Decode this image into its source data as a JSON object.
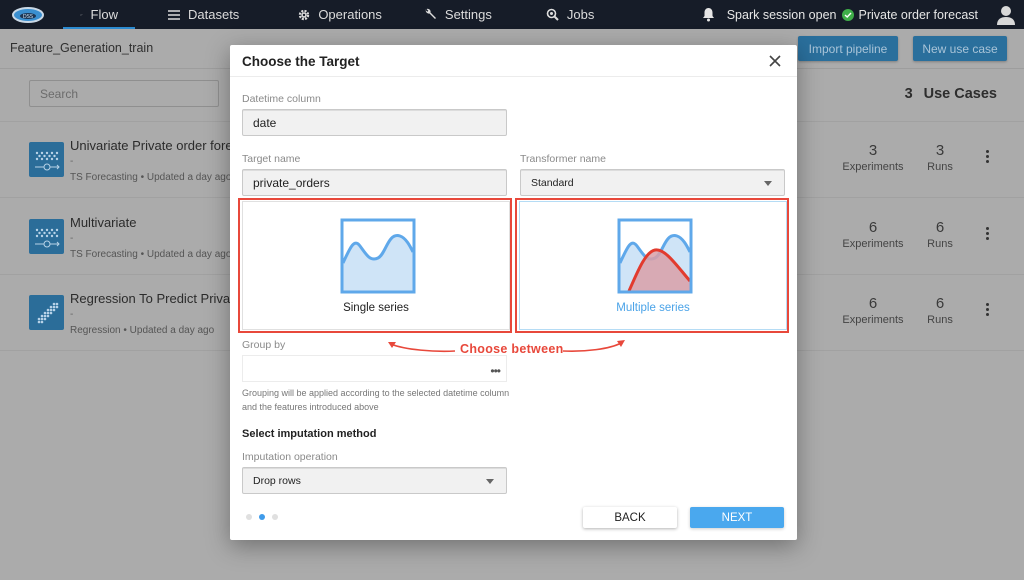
{
  "nav": {
    "items": [
      {
        "label": "Flow",
        "icon": "trend-line-icon",
        "active": true
      },
      {
        "label": "Datasets",
        "icon": "list-icon",
        "active": false
      },
      {
        "label": "Operations",
        "icon": "gear-icon",
        "active": false
      },
      {
        "label": "Settings",
        "icon": "wrench-icon",
        "active": false
      },
      {
        "label": "Jobs",
        "icon": "search-cog-icon",
        "active": false
      }
    ],
    "session_status": "Spark session open",
    "project_name": "Private order forecast"
  },
  "header": {
    "project_title": "Feature_Generation_train",
    "import_label": "Import pipeline",
    "new_label": "New use case"
  },
  "search": {
    "placeholder": "Search"
  },
  "use_cases": {
    "count": "3",
    "count_label": "Use Cases",
    "items": [
      {
        "title": "Univariate Private order forec",
        "subtitle": "-",
        "type": "TS Forecasting",
        "updated": "• Updated a day ago",
        "experiments": "3",
        "experiments_label": "Experiments",
        "runs": "3",
        "runs_label": "Runs"
      },
      {
        "title": "Multivariate",
        "subtitle": "-",
        "type": "TS Forecasting",
        "updated": "• Updated a day ago",
        "experiments": "6",
        "experiments_label": "Experiments",
        "runs": "6",
        "runs_label": "Runs"
      },
      {
        "title": "Regression To Predict Private",
        "subtitle": "-",
        "type": "Regression",
        "updated": "• Updated a day ago",
        "experiments": "6",
        "experiments_label": "Experiments",
        "runs": "6",
        "runs_label": "Runs"
      }
    ]
  },
  "modal": {
    "title": "Choose the Target",
    "datetime_label": "Datetime column",
    "datetime_value": "date",
    "target_label": "Target name",
    "target_value": "private_orders",
    "transformer_label": "Transformer name",
    "transformer_value": "Standard",
    "option_single": "Single series",
    "option_multiple": "Multiple series",
    "selected_option": "Multiple series",
    "annotation": "Choose between",
    "groupby_label": "Group by",
    "groupby_value": "",
    "groupby_help": "Grouping will be applied according to the selected datetime column and the features introduced above",
    "imputation_section": "Select imputation method",
    "imputation_label": "Imputation operation",
    "imputation_value": "Drop rows",
    "step_current": 2,
    "step_total": 3,
    "back_label": "BACK",
    "next_label": "NEXT"
  },
  "colors": {
    "accent": "#4aa8ee",
    "annotation": "#e8483b",
    "nav_bg": "#161c28",
    "status_ok": "#3fae49"
  }
}
